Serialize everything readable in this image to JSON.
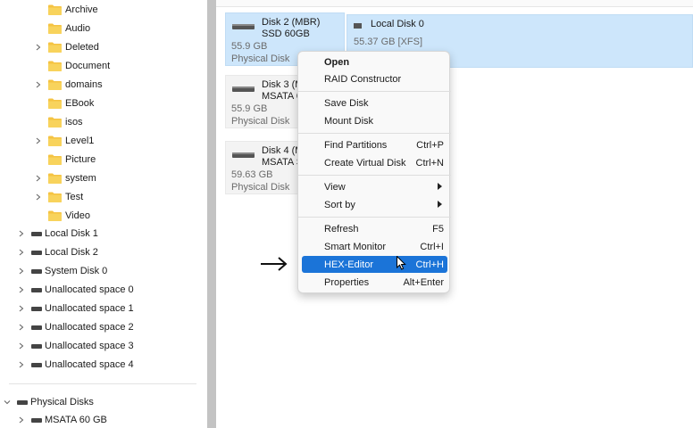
{
  "tree": {
    "folders": [
      {
        "label": "Archive",
        "chevron": false
      },
      {
        "label": "Audio",
        "chevron": false
      },
      {
        "label": "Deleted",
        "chevron": true
      },
      {
        "label": "Document",
        "chevron": false
      },
      {
        "label": "domains",
        "chevron": true
      },
      {
        "label": "EBook",
        "chevron": false
      },
      {
        "label": "isos",
        "chevron": false
      },
      {
        "label": "Level1",
        "chevron": true
      },
      {
        "label": "Picture",
        "chevron": false
      },
      {
        "label": "system",
        "chevron": true
      },
      {
        "label": "Test",
        "chevron": true
      },
      {
        "label": "Video",
        "chevron": false
      }
    ],
    "volumes": [
      {
        "label": "Local Disk 1"
      },
      {
        "label": "Local Disk 2"
      },
      {
        "label": "System Disk 0"
      },
      {
        "label": "Unallocated space 0"
      },
      {
        "label": "Unallocated space 1"
      },
      {
        "label": "Unallocated space 2"
      },
      {
        "label": "Unallocated space 3"
      },
      {
        "label": "Unallocated space 4"
      }
    ],
    "physical_disks": {
      "label": "Physical Disks"
    },
    "physical_child": {
      "label": "MSATA 60 GB"
    }
  },
  "disks": [
    {
      "name": "Disk 2 (MBR)",
      "model": "SSD 60GB",
      "size": "55.9 GB",
      "kind": "Physical Disk",
      "selected": true
    },
    {
      "name": "Disk 3 (M",
      "model": "MSATA 6",
      "size": "55.9 GB",
      "kind": "Physical Disk",
      "selected": false
    },
    {
      "name": "Disk 4 (M",
      "model": "MSATA S",
      "size": "59.63 GB",
      "kind": "Physical Disk",
      "selected": false
    }
  ],
  "partition": {
    "name": "Local Disk 0",
    "size": "55.37 GB [XFS]"
  },
  "context_menu": {
    "items": [
      {
        "label": "Open",
        "shortcut": "",
        "bold": true
      },
      {
        "label": "RAID Constructor",
        "shortcut": ""
      },
      {
        "label": "Save Disk",
        "shortcut": ""
      },
      {
        "label": "Mount Disk",
        "shortcut": ""
      },
      {
        "label": "Find Partitions",
        "shortcut": "Ctrl+P"
      },
      {
        "label": "Create Virtual Disk",
        "shortcut": "Ctrl+N"
      },
      {
        "label": "View",
        "shortcut": "",
        "submenu": true
      },
      {
        "label": "Sort by",
        "shortcut": "",
        "submenu": true
      },
      {
        "label": "Refresh",
        "shortcut": "F5"
      },
      {
        "label": "Smart Monitor",
        "shortcut": "Ctrl+I"
      },
      {
        "label": "HEX-Editor",
        "shortcut": "Ctrl+H",
        "highlighted": true
      },
      {
        "label": "Properties",
        "shortcut": "Alt+Enter"
      }
    ]
  },
  "colors": {
    "highlight": "#1b74d8",
    "selection": "#cde6fb",
    "folder": "#f5c342",
    "splitter": "#c3c3c3"
  },
  "icons": {
    "folder": "folder-icon",
    "drive": "drive-icon",
    "chevron": "chevron-right-icon",
    "arrow": "right-arrow-icon",
    "cursor": "mouse-cursor-icon"
  }
}
